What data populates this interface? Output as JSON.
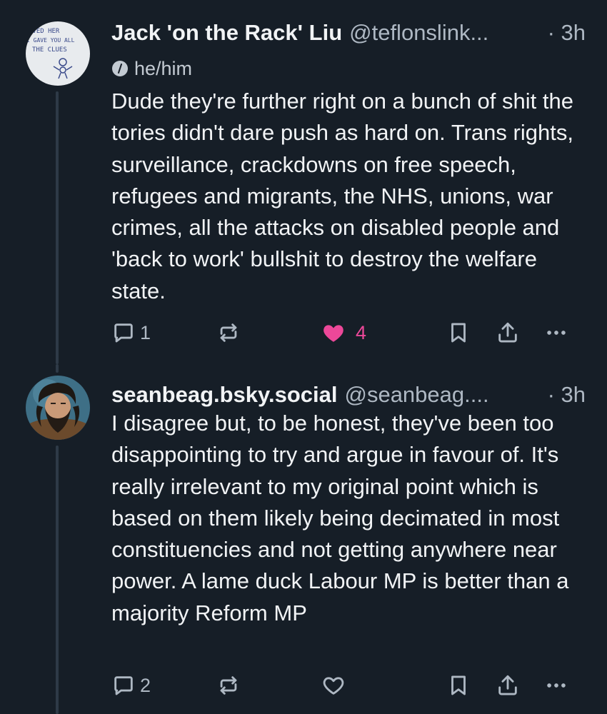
{
  "posts": [
    {
      "display_name": "Jack 'on the Rack' Liu",
      "handle": "@teflonslink...",
      "time": "· 3h",
      "pronouns": "he/him",
      "avatar_lines": [
        "AVED HER",
        "I GAVE YOU ALL",
        "THE CLUES"
      ],
      "text": "Dude they're further right on a bunch of shit the tories didn't dare push as hard on. Trans rights, surveillance, crackdowns on free speech, refugees and migrants, the NHS, unions, war crimes, all the attacks on disabled people and 'back to work' bullshit to destroy the welfare state.",
      "reply_count": "1",
      "like_count": "4",
      "liked": true
    },
    {
      "display_name": "seanbeag.bsky.social",
      "handle": "@seanbeag....",
      "time": "· 3h",
      "text": "I disagree but, to be honest, they've been too disappointing to try and argue in favour of. It's really irrelevant to my original point which is based on them likely being decimated in most constituencies and not getting anywhere near power. A lame duck Labour MP is better than a majority Reform MP",
      "reply_count": "2",
      "like_count": "",
      "liked": false
    }
  ],
  "colors": {
    "background": "#161e27",
    "text": "#f1f3f5",
    "muted": "#aeb8c3",
    "like": "#ec4899",
    "thread_line": "#2e3a47"
  }
}
